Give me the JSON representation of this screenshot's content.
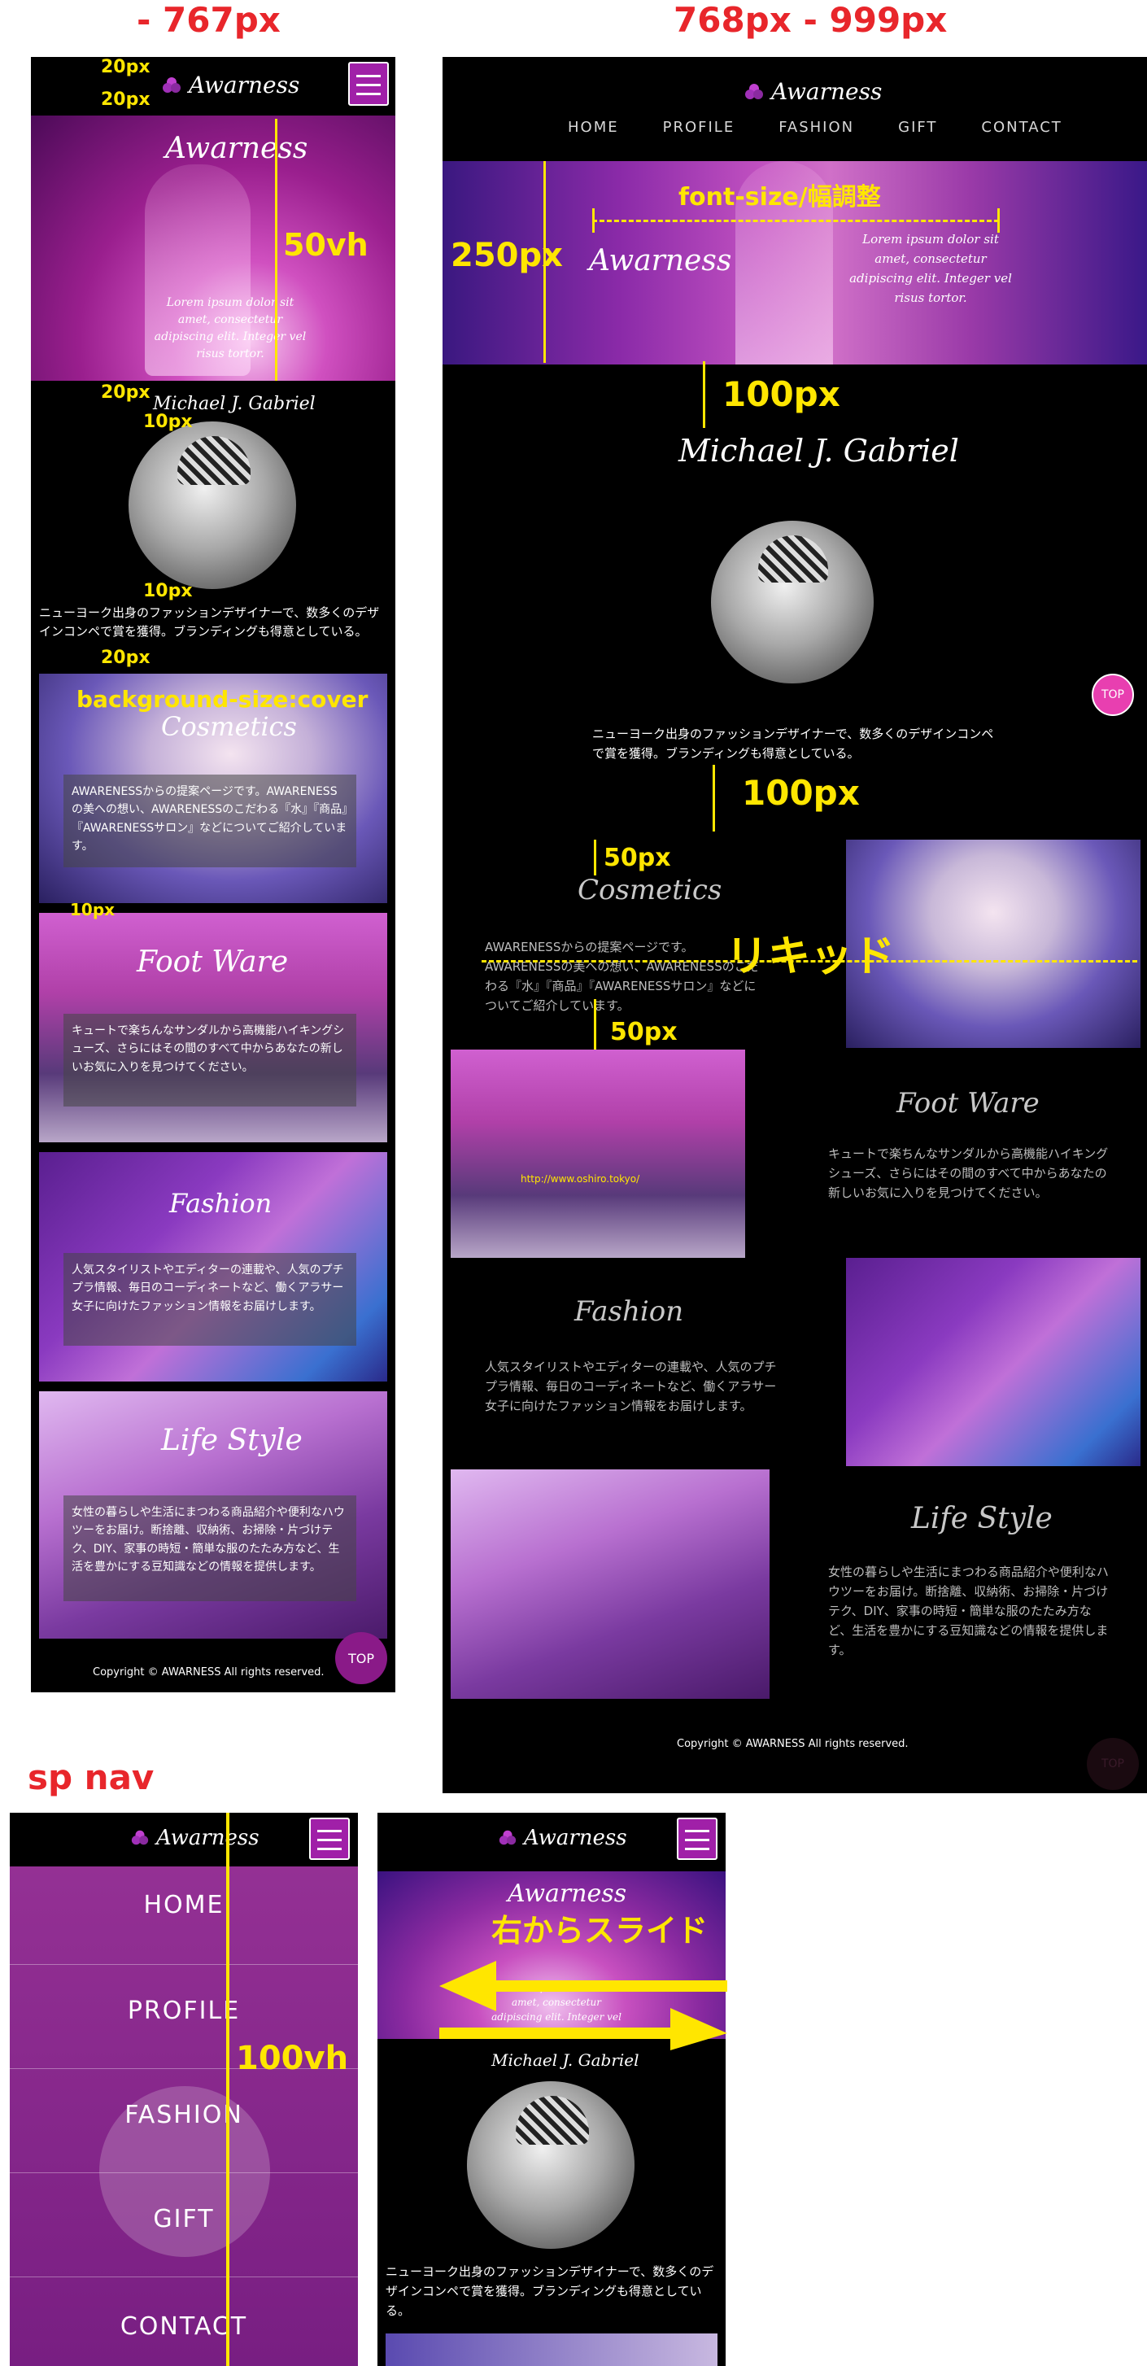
{
  "section_labels": {
    "sp": "- 767px",
    "tablet": "768px - 999px",
    "spnav": "sp nav"
  },
  "annotations": {
    "pad_top_1": "20px",
    "pad_top_2": "20px",
    "hero_height": "50vh",
    "pad_after_hero": "20px",
    "pad_10_a": "10px",
    "pad_10_b": "10px",
    "pad_20_c": "20px",
    "bg_cover": "background-size:cover",
    "pad_10_c": "10px",
    "hero_height_tb": "250px",
    "font_size_note": "font-size/幅調整",
    "gap_100_a": "100px",
    "gap_100_b": "100px",
    "gap_50_a": "50px",
    "gap_50_b": "50px",
    "liquid": "リキッド",
    "slide_note": "右からスライド",
    "nav_height": "100vh"
  },
  "site": {
    "logo": "Awarness",
    "hero_title": "Awarness",
    "hero_text": "Lorem ipsum dolor sit amet, consectetur adipiscing elit. Integer vel risus tortor.",
    "name": "Michael J. Gabriel",
    "bio": "ニューヨーク出身のファッションデザイナーで、数多くのデザインコンペで賞を獲得。ブランディングも得意としている。",
    "top_label": "TOP",
    "copyright": "Copyright © AWARNESS All rights reserved.",
    "watermark_url": "http://www.oshiro.tokyo/"
  },
  "nav": {
    "items": [
      "HOME",
      "PROFILE",
      "FASHION",
      "GIFT",
      "CONTACT"
    ]
  },
  "sections": [
    {
      "title": "Cosmetics",
      "text": "AWARENESSからの提案ページです。AWARENESSの美への想い、AWARENESSのこだわる『水』『商品』『AWARENESSサロン』などについてご紹介しています。"
    },
    {
      "title": "Foot Ware",
      "text": "キュートで楽ちんなサンダルから高機能ハイキングシューズ、さらにはその間のすべて中からあなたの新しいお気に入りを見つけてください。"
    },
    {
      "title": "Fashion",
      "text": "人気スタイリストやエディターの連載や、人気のプチプラ情報、毎日のコーディネートなど、働くアラサー女子に向けたファッション情報をお届けします。"
    },
    {
      "title": "Life Style",
      "text": "女性の暮らしや生活にまつわる商品紹介や便利なハウツーをお届け。断捨離、収納術、お掃除・片づけテク、DIY、家事の時短・簡単な服のたたみ方など、生活を豊かにする豆知識などの情報を提供します。"
    }
  ],
  "colors": {
    "annotation_yellow": "#ffe600",
    "heading_red": "#e8262b",
    "accent_purple": "#a020a8",
    "top_pink": "#e83fb0"
  },
  "icons": [
    "menu-icon",
    "logo-flower-icon",
    "arrow-left-icon",
    "arrow-right-icon"
  ]
}
